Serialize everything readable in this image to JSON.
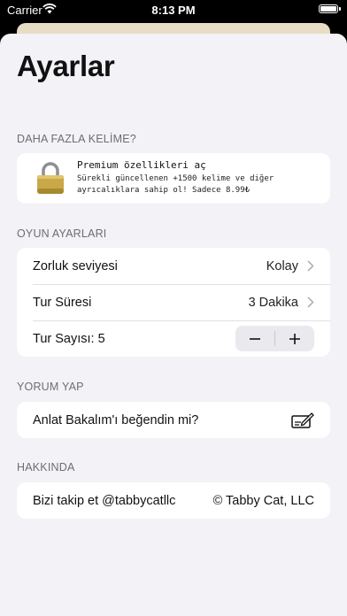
{
  "status_bar": {
    "carrier": "Carrier",
    "time": "8:13 PM"
  },
  "page": {
    "title": "Ayarlar"
  },
  "premium_section": {
    "header": "DAHA FAZLA KELİME?",
    "title": "Premium özellikleri aç",
    "description_line1": "Sürekli güncellenen +1500 kelime ve diğer",
    "description_line2": "ayrıcalıklara sahip ol! Sadece 8.99₺",
    "icon": "lock-icon"
  },
  "game_settings": {
    "header": "OYUN AYARLARI",
    "difficulty": {
      "label": "Zorluk seviyesi",
      "value": "Kolay"
    },
    "round_time": {
      "label": "Tur Süresi",
      "value": "3 Dakika"
    },
    "round_count": {
      "label": "Tur Sayısı: 5",
      "value": 5,
      "minus": "−",
      "plus": "+"
    }
  },
  "review_section": {
    "header": "YORUM YAP",
    "label": "Anlat Bakalım'ı beğendin mi?",
    "icon": "write-review-icon"
  },
  "about_section": {
    "header": "HAKKINDA",
    "follow_label": "Bizi takip et @tabbycatllc",
    "copyright": "© Tabby Cat, LLC"
  },
  "colors": {
    "background": "#f2f2f7",
    "card": "#ffffff",
    "header_text": "#6d6d72",
    "lock_gold": "#c9a84a"
  }
}
